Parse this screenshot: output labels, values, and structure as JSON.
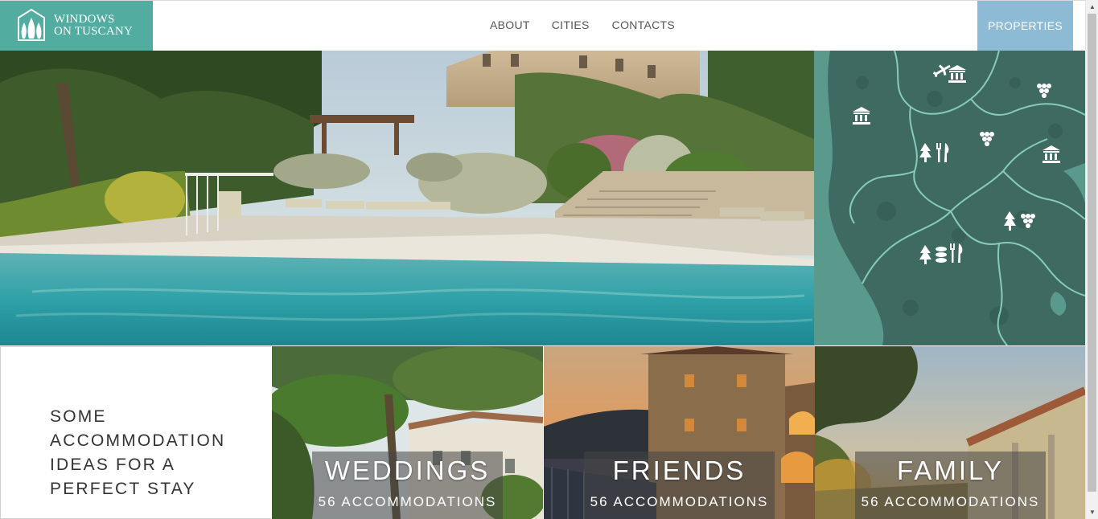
{
  "header": {
    "logo_line1": "WINDOWS",
    "logo_line2": "ON TUSCANY",
    "nav": [
      {
        "label": "ABOUT"
      },
      {
        "label": "CITIES"
      },
      {
        "label": "CONTACTS"
      }
    ],
    "properties_label": "PROPERTIES"
  },
  "colors": {
    "brand_teal": "#52aca0",
    "properties_blue": "#8dbbd6",
    "map_green": "#3f6e66",
    "map_borders": "#8fd6c4"
  },
  "map": {
    "icons": [
      "airplane-icon",
      "museum-icon",
      "grapes-icon",
      "tree-icon",
      "cutlery-icon",
      "food-icon"
    ]
  },
  "intro": {
    "line1": "SOME",
    "line2": "ACCOMMODATION",
    "line3": "IDEAS FOR A",
    "line4": "PERFECT STAY"
  },
  "categories": [
    {
      "title": "WEDDINGS",
      "count": "56 ACCOMMODATIONS"
    },
    {
      "title": "FRIENDS",
      "count": "56 ACCOMMODATIONS"
    },
    {
      "title": "FAMILY",
      "count": "56 ACCOMMODATIONS"
    }
  ]
}
